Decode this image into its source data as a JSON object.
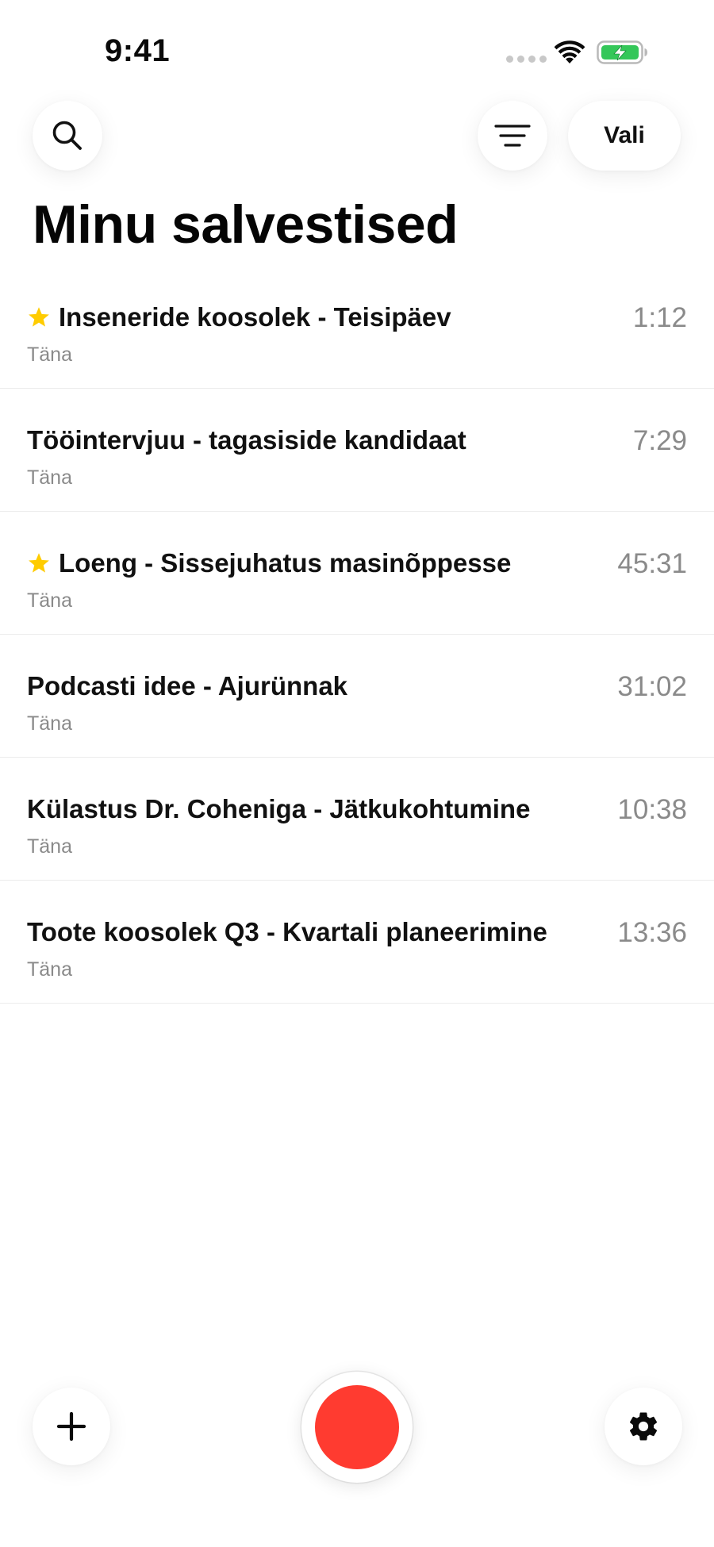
{
  "status_bar": {
    "time": "9:41",
    "icons": [
      "signal-icon",
      "wifi-icon",
      "battery-charging-icon"
    ],
    "battery_color": "#34c759"
  },
  "header": {
    "search_icon": "search-icon",
    "filter_icon": "filter-icon",
    "select_label": "Vali",
    "title": "Minu salvestised"
  },
  "recordings": [
    {
      "starred": true,
      "title": "Inseneride koosolek - Teisipäev",
      "date": "Täna",
      "duration": "1:12"
    },
    {
      "starred": false,
      "title": "Tööintervjuu - tagasiside kandidaat",
      "date": "Täna",
      "duration": "7:29"
    },
    {
      "starred": true,
      "title": "Loeng - Sissejuhatus masinõppesse",
      "date": "Täna",
      "duration": "45:31"
    },
    {
      "starred": false,
      "title": "Podcasti idee - Ajurünnak",
      "date": "Täna",
      "duration": "31:02"
    },
    {
      "starred": false,
      "title": "Külastus Dr. Coheniga - Jätkukohtumine",
      "date": "Täna",
      "duration": "10:38"
    },
    {
      "starred": false,
      "title": "Toote koosolek Q3 - Kvartali planeerimine",
      "date": "Täna",
      "duration": "13:36"
    }
  ],
  "toolbar": {
    "add_icon": "plus-icon",
    "record_icon": "record-icon",
    "settings_icon": "gear-icon"
  },
  "colors": {
    "star": "#ffcc00",
    "record": "#ff3b30",
    "secondary_text": "#8a8a8a"
  }
}
